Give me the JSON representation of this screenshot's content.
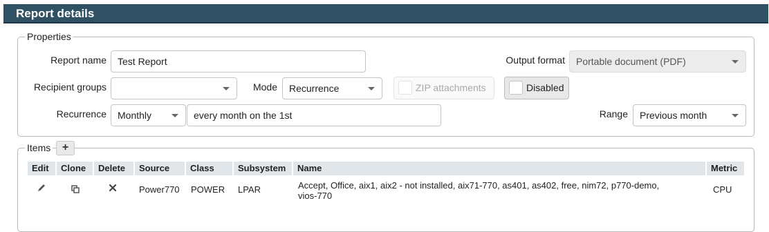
{
  "header": {
    "title": "Report details"
  },
  "properties": {
    "legend": "Properties",
    "report_name_label": "Report name",
    "report_name_value": "Test Report",
    "output_format_label": "Output format",
    "output_format_value": "Portable document (PDF)",
    "recipient_groups_label": "Recipient groups",
    "recipient_groups_value": "",
    "mode_label": "Mode",
    "mode_value": "Recurrence",
    "zip_label": "ZIP attachments",
    "disabled_label": "Disabled",
    "recurrence_label": "Recurrence",
    "recurrence_value": "Monthly",
    "recurrence_text": "every month on the 1st",
    "range_label": "Range",
    "range_value": "Previous month"
  },
  "items": {
    "legend": "Items",
    "add_label": "+",
    "columns": [
      "Edit",
      "Clone",
      "Delete",
      "Source",
      "Class",
      "Subsystem",
      "Name",
      "Metric"
    ],
    "rows": [
      {
        "source": "Power770",
        "class": "POWER",
        "subsystem": "LPAR",
        "name_line1": "Accept, Office, aix1, aix2 - not installed, aix71-770, as401, as402, free, nim72, p770-demo,",
        "name_line2": "vios-770",
        "metric": "CPU"
      }
    ]
  },
  "icons": {
    "edit": "pencil-icon",
    "clone": "clone-icon",
    "delete": "close-icon"
  }
}
